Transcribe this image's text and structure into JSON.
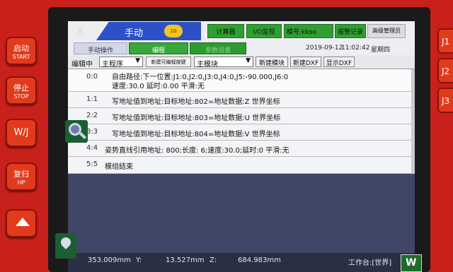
{
  "side_keys": [
    {
      "line1": "启动",
      "line2": "START"
    },
    {
      "line1": "停止",
      "line2": "STOP"
    },
    {
      "line1": "W/J",
      "line2": ""
    },
    {
      "line1": "复归",
      "line2": "HP"
    }
  ],
  "right_keys": [
    "J1",
    "J2",
    "J3"
  ],
  "topbar": {
    "mode": "手动",
    "speed": "10",
    "calculator": "计算器",
    "io_monitor": "I/O监视",
    "model": "模号:kkoo",
    "alarm_log": "报警记录",
    "user_level": "高级管理员"
  },
  "tabs": {
    "manual": "手动操作",
    "program": "编程",
    "params": "参数设置"
  },
  "datetime": {
    "date": "2019-09-12",
    "time": "11:02:42",
    "weekday": "星期四"
  },
  "toolbar": {
    "editing_label": "编辑中",
    "program_select": "主程序",
    "new_prog_button": "新建可编程按键",
    "module_select": "主模块",
    "new_module": "新建模块",
    "new_dxf": "新建DXF",
    "show_dxf": "显示DXF"
  },
  "program_rows": [
    {
      "num": "0:0",
      "line1": "自由路径:下一位置:J1:0,J2:0,J3:0,J4:0,J5:-90.000,J6:0",
      "line2": "速度:30.0 延时:0.00 平滑:无"
    },
    {
      "num": "1:1",
      "line1": "写地址值到地址:目标地址:802=地址数据:Z 世界坐标",
      "line2": ""
    },
    {
      "num": "2:2",
      "line1": "写地址值到地址:目标地址:803=地址数据:U 世界坐标",
      "line2": ""
    },
    {
      "num": "3:3",
      "line1": "写地址值到地址:目标地址:804=地址数据:V 世界坐标",
      "line2": ""
    },
    {
      "num": "4:4",
      "line1": "姿势直线引用地址:  800;长度: 6;速度:30.0;延时:0 平滑:无",
      "line2": ""
    },
    {
      "num": "5:5",
      "line1": "模组结束",
      "line2": ""
    }
  ],
  "status": {
    "x_label": "X:",
    "x_value": "353.009mm",
    "y_label": "Y:",
    "y_value": "13.527mm",
    "z_label": "Z:",
    "z_value": "684.983mm",
    "frame": "工作台:[世界]",
    "w_button": "W"
  },
  "colors": {
    "housing": "#c8201a",
    "mode_tab": "#2b50c8",
    "active_tab": "#37a83a",
    "status_bg": "#2a2f44"
  }
}
